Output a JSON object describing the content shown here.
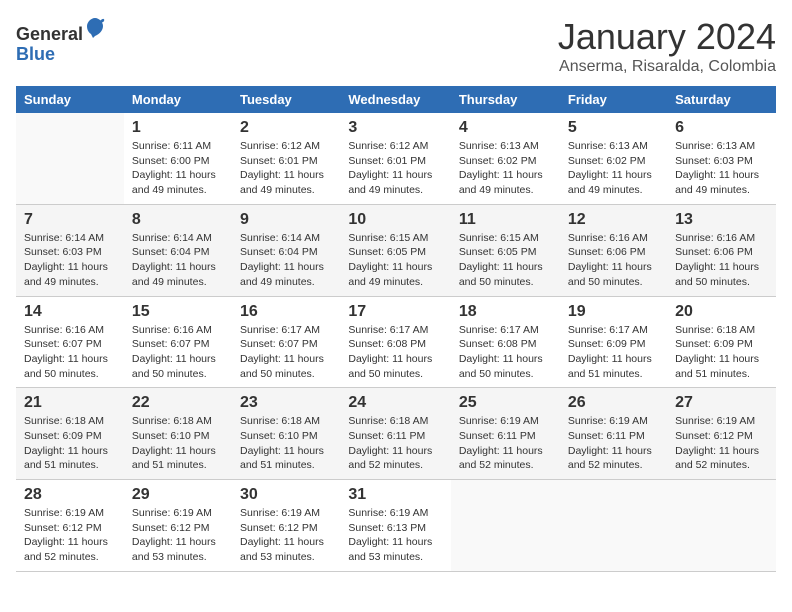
{
  "header": {
    "logo_line1": "General",
    "logo_line2": "Blue",
    "month_title": "January 2024",
    "subtitle": "Anserma, Risaralda, Colombia"
  },
  "days_of_week": [
    "Sunday",
    "Monday",
    "Tuesday",
    "Wednesday",
    "Thursday",
    "Friday",
    "Saturday"
  ],
  "weeks": [
    [
      {
        "num": "",
        "info": ""
      },
      {
        "num": "1",
        "info": "Sunrise: 6:11 AM\nSunset: 6:00 PM\nDaylight: 11 hours\nand 49 minutes."
      },
      {
        "num": "2",
        "info": "Sunrise: 6:12 AM\nSunset: 6:01 PM\nDaylight: 11 hours\nand 49 minutes."
      },
      {
        "num": "3",
        "info": "Sunrise: 6:12 AM\nSunset: 6:01 PM\nDaylight: 11 hours\nand 49 minutes."
      },
      {
        "num": "4",
        "info": "Sunrise: 6:13 AM\nSunset: 6:02 PM\nDaylight: 11 hours\nand 49 minutes."
      },
      {
        "num": "5",
        "info": "Sunrise: 6:13 AM\nSunset: 6:02 PM\nDaylight: 11 hours\nand 49 minutes."
      },
      {
        "num": "6",
        "info": "Sunrise: 6:13 AM\nSunset: 6:03 PM\nDaylight: 11 hours\nand 49 minutes."
      }
    ],
    [
      {
        "num": "7",
        "info": "Sunrise: 6:14 AM\nSunset: 6:03 PM\nDaylight: 11 hours\nand 49 minutes."
      },
      {
        "num": "8",
        "info": "Sunrise: 6:14 AM\nSunset: 6:04 PM\nDaylight: 11 hours\nand 49 minutes."
      },
      {
        "num": "9",
        "info": "Sunrise: 6:14 AM\nSunset: 6:04 PM\nDaylight: 11 hours\nand 49 minutes."
      },
      {
        "num": "10",
        "info": "Sunrise: 6:15 AM\nSunset: 6:05 PM\nDaylight: 11 hours\nand 49 minutes."
      },
      {
        "num": "11",
        "info": "Sunrise: 6:15 AM\nSunset: 6:05 PM\nDaylight: 11 hours\nand 50 minutes."
      },
      {
        "num": "12",
        "info": "Sunrise: 6:16 AM\nSunset: 6:06 PM\nDaylight: 11 hours\nand 50 minutes."
      },
      {
        "num": "13",
        "info": "Sunrise: 6:16 AM\nSunset: 6:06 PM\nDaylight: 11 hours\nand 50 minutes."
      }
    ],
    [
      {
        "num": "14",
        "info": "Sunrise: 6:16 AM\nSunset: 6:07 PM\nDaylight: 11 hours\nand 50 minutes."
      },
      {
        "num": "15",
        "info": "Sunrise: 6:16 AM\nSunset: 6:07 PM\nDaylight: 11 hours\nand 50 minutes."
      },
      {
        "num": "16",
        "info": "Sunrise: 6:17 AM\nSunset: 6:07 PM\nDaylight: 11 hours\nand 50 minutes."
      },
      {
        "num": "17",
        "info": "Sunrise: 6:17 AM\nSunset: 6:08 PM\nDaylight: 11 hours\nand 50 minutes."
      },
      {
        "num": "18",
        "info": "Sunrise: 6:17 AM\nSunset: 6:08 PM\nDaylight: 11 hours\nand 50 minutes."
      },
      {
        "num": "19",
        "info": "Sunrise: 6:17 AM\nSunset: 6:09 PM\nDaylight: 11 hours\nand 51 minutes."
      },
      {
        "num": "20",
        "info": "Sunrise: 6:18 AM\nSunset: 6:09 PM\nDaylight: 11 hours\nand 51 minutes."
      }
    ],
    [
      {
        "num": "21",
        "info": "Sunrise: 6:18 AM\nSunset: 6:09 PM\nDaylight: 11 hours\nand 51 minutes."
      },
      {
        "num": "22",
        "info": "Sunrise: 6:18 AM\nSunset: 6:10 PM\nDaylight: 11 hours\nand 51 minutes."
      },
      {
        "num": "23",
        "info": "Sunrise: 6:18 AM\nSunset: 6:10 PM\nDaylight: 11 hours\nand 51 minutes."
      },
      {
        "num": "24",
        "info": "Sunrise: 6:18 AM\nSunset: 6:11 PM\nDaylight: 11 hours\nand 52 minutes."
      },
      {
        "num": "25",
        "info": "Sunrise: 6:19 AM\nSunset: 6:11 PM\nDaylight: 11 hours\nand 52 minutes."
      },
      {
        "num": "26",
        "info": "Sunrise: 6:19 AM\nSunset: 6:11 PM\nDaylight: 11 hours\nand 52 minutes."
      },
      {
        "num": "27",
        "info": "Sunrise: 6:19 AM\nSunset: 6:12 PM\nDaylight: 11 hours\nand 52 minutes."
      }
    ],
    [
      {
        "num": "28",
        "info": "Sunrise: 6:19 AM\nSunset: 6:12 PM\nDaylight: 11 hours\nand 52 minutes."
      },
      {
        "num": "29",
        "info": "Sunrise: 6:19 AM\nSunset: 6:12 PM\nDaylight: 11 hours\nand 53 minutes."
      },
      {
        "num": "30",
        "info": "Sunrise: 6:19 AM\nSunset: 6:12 PM\nDaylight: 11 hours\nand 53 minutes."
      },
      {
        "num": "31",
        "info": "Sunrise: 6:19 AM\nSunset: 6:13 PM\nDaylight: 11 hours\nand 53 minutes."
      },
      {
        "num": "",
        "info": ""
      },
      {
        "num": "",
        "info": ""
      },
      {
        "num": "",
        "info": ""
      }
    ]
  ]
}
